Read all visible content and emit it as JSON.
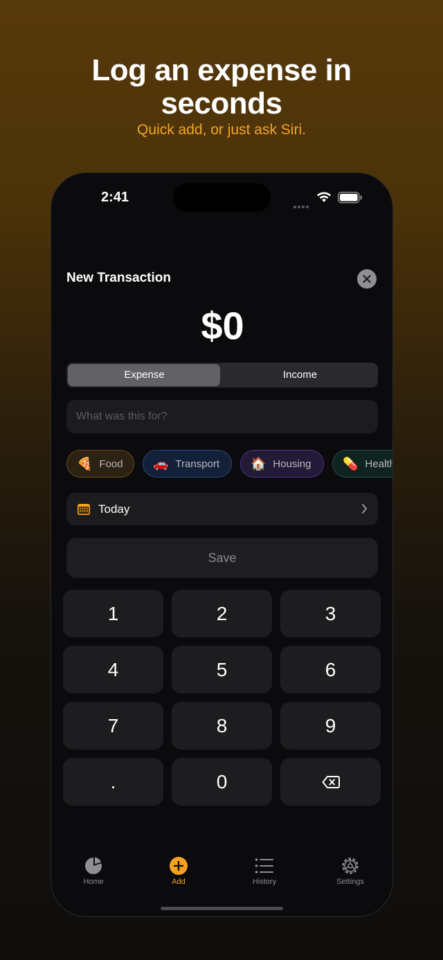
{
  "promo": {
    "headline_line1": "Log an expense in",
    "headline_line2": "seconds",
    "subline": "Quick add, or just ask Siri."
  },
  "status_bar": {
    "time": "2:41"
  },
  "sheet": {
    "title": "New Transaction",
    "amount": "$0",
    "type_segments": [
      "Expense",
      "Income"
    ],
    "selected_segment": "Expense",
    "note_placeholder": "What was this for?",
    "categories": [
      {
        "emoji": "🍕",
        "label": "Food"
      },
      {
        "emoji": "🚗",
        "label": "Transport"
      },
      {
        "emoji": "🏠",
        "label": "Housing"
      },
      {
        "emoji": "💊",
        "label": "Health"
      }
    ],
    "date_label": "Today",
    "save_label": "Save"
  },
  "keypad": [
    "1",
    "2",
    "3",
    "4",
    "5",
    "6",
    "7",
    "8",
    "9",
    ".",
    "0",
    "backspace-icon"
  ],
  "tabs": [
    {
      "label": "Home",
      "icon": "pie-chart-icon"
    },
    {
      "label": "Add",
      "icon": "plus-circle-icon",
      "active": true
    },
    {
      "label": "History",
      "icon": "list-icon"
    },
    {
      "label": "Settings",
      "icon": "gear-icon"
    }
  ],
  "colors": {
    "accent": "#f5a21e",
    "subline": "#f2a52a",
    "background": "#0b0b0d"
  }
}
